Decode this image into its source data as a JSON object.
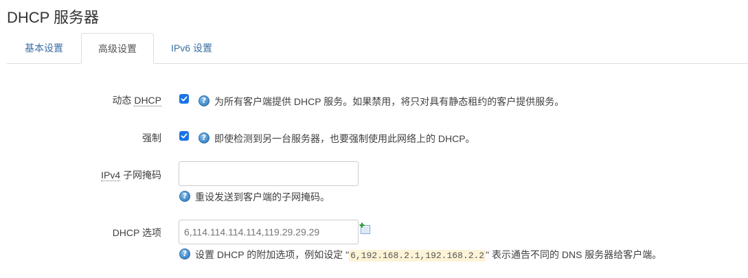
{
  "page": {
    "title": "DHCP 服务器"
  },
  "tabs": [
    {
      "label": "基本设置",
      "active": false
    },
    {
      "label": "高级设置",
      "active": true
    },
    {
      "label": "IPv6 设置",
      "active": false
    }
  ],
  "fields": {
    "dynamic_dhcp": {
      "label_prefix": "动态 ",
      "label_abbr": "DHCP",
      "checked": true,
      "description": "为所有客户端提供 DHCP 服务。如果禁用，将只对具有静态租约的客户提供服务。"
    },
    "force": {
      "label": "强制",
      "checked": true,
      "description": "即使检测到另一台服务器，也要强制使用此网络上的 DHCP。"
    },
    "ipv4_netmask": {
      "label_abbr": "IPv4",
      "label_suffix": " 子网掩码",
      "value": "",
      "description": "重设发送到客户端的子网掩码。"
    },
    "dhcp_options": {
      "label": "DHCP 选项",
      "placeholder": "6,114.114.114.114,119.29.29.29",
      "value": "",
      "description_prefix": "设置 DHCP 的附加选项，例如设定 \"",
      "description_code": "6,192.168.2.1,192.168.2.2",
      "description_suffix": "\" 表示通告不同的 DNS 服务器给客户端。"
    }
  },
  "colors": {
    "link_blue": "#3a6ea5",
    "checkbox_blue": "#1a73e8",
    "code_bg": "#fdf3d6"
  },
  "icons": {
    "help": "help-icon",
    "add": "add-field-icon"
  }
}
